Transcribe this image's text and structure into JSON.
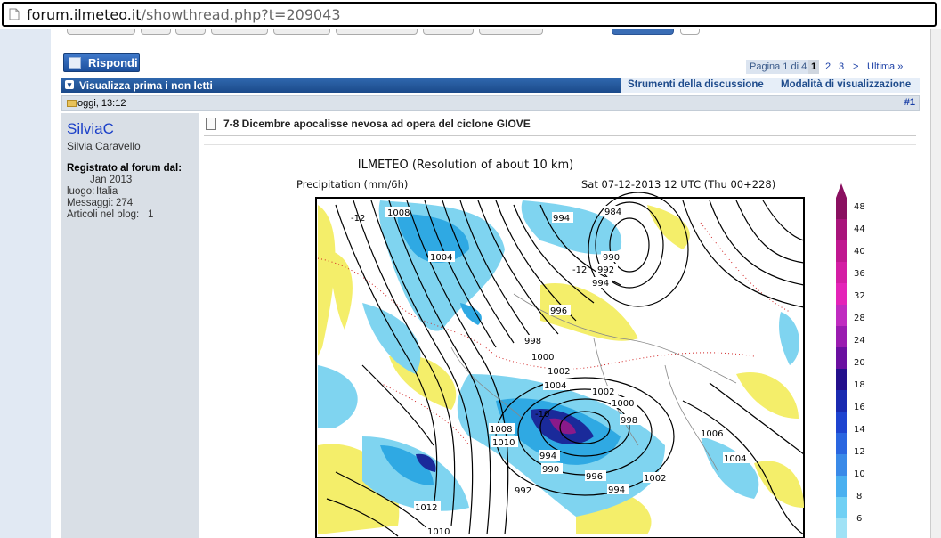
{
  "browser": {
    "url_host": "forum.ilmeteo.it",
    "url_path": "/showthread.php?t=209043"
  },
  "toolbar": {
    "reply_label": "Rispondi"
  },
  "pagination": {
    "page_of": "Pagina 1 di 4",
    "current": "1",
    "pages": [
      "2",
      "3"
    ],
    "next": ">",
    "last": "Ultima »"
  },
  "thread_bar": {
    "title": "Visualizza prima i non letti",
    "tools": "Strumenti della discussione",
    "view_mode": "Modalità di visualizzazione"
  },
  "post": {
    "date": "oggi, 13:12",
    "number": "#1",
    "title": "7-8 Dicembre apocalisse nevosa ad opera del ciclone GIOVE"
  },
  "user": {
    "name": "SilviaC",
    "full_name": "Silvia Caravello",
    "registered_label": "Registrato al forum dal:",
    "registered_value": "Jan 2013",
    "location_label": "luogo:",
    "location_value": "Italia",
    "messages_label": "Messaggi:",
    "messages_value": "274",
    "blog_label": "Articoli nel blog:",
    "blog_value": "1"
  },
  "map": {
    "title": "ILMETEO (Resolution of about 10 km)",
    "subtitle_left": "Precipitation (mm/6h)",
    "subtitle_right": "Sat 07-12-2013 12 UTC (Thu 00+228)",
    "scale_labels": [
      "48",
      "44",
      "40",
      "36",
      "32",
      "28",
      "24",
      "20",
      "18",
      "16",
      "14",
      "12",
      "10",
      "8",
      "6"
    ],
    "pressure_labels": [
      "1008",
      "994",
      "984",
      "1004",
      "990",
      "992",
      "994",
      "996",
      "998",
      "1000",
      "1002",
      "1004",
      "1002",
      "1000",
      "998",
      "1006",
      "1010",
      "1008",
      "994",
      "990",
      "992",
      "996",
      "994",
      "1002",
      "1004",
      "1012",
      "1010",
      "-12",
      "-12",
      "-10"
    ],
    "colors": {
      "light_blue": "#7fd4f0",
      "cyan": "#2fa9e3",
      "yellow": "#f4ee6a",
      "purple": "#8a1a8a",
      "navy": "#1a2a9a"
    }
  },
  "colors": {
    "accent": "#1b4a8a",
    "link": "#1a3fa6"
  }
}
